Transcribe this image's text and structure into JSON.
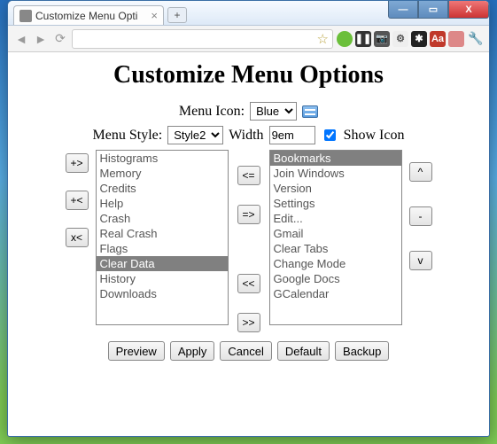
{
  "window": {
    "tab_title": "Customize Menu Opti",
    "newtab_glyph": "+",
    "min_glyph": "—",
    "max_glyph": "▭",
    "close_glyph": "X"
  },
  "toolbar": {
    "back_glyph": "◄",
    "fwd_glyph": "►",
    "reload_glyph": "⟳",
    "star_glyph": "☆",
    "wrench_glyph": "🔧",
    "ext_icons": [
      {
        "name": "green-dot",
        "bg": "#6bbf3a",
        "glyph": ""
      },
      {
        "name": "pause",
        "bg": "#333",
        "glyph": "❚❚"
      },
      {
        "name": "camera",
        "bg": "#555",
        "glyph": "📷"
      },
      {
        "name": "gears",
        "bg": "#eee",
        "glyph": "⚙",
        "fg": "#555"
      },
      {
        "name": "asterisk",
        "bg": "#222",
        "glyph": "✱"
      },
      {
        "name": "aa",
        "bg": "#c0392b",
        "glyph": "Aa"
      },
      {
        "name": "blank",
        "bg": "#d88",
        "glyph": ""
      }
    ]
  },
  "page": {
    "heading": "Customize Menu Options",
    "menu_icon_label": "Menu Icon:",
    "menu_icon_value": "Blue",
    "menu_style_label": "Menu Style:",
    "menu_style_value": "Style2",
    "width_label": "Width",
    "width_value": "9em",
    "show_icon_label": "Show Icon",
    "show_icon_checked": true
  },
  "left_list": {
    "items": [
      "Histograms",
      "Memory",
      "Credits",
      "Help",
      "Crash",
      "Real Crash",
      "Flags",
      "Clear Data",
      "History",
      "Downloads"
    ],
    "selected_index": 7
  },
  "right_list": {
    "items": [
      "Bookmarks",
      "Join Windows",
      "Version",
      "Settings",
      "Edit...",
      "Gmail",
      "Clear Tabs",
      "Change Mode",
      "Google Docs",
      "GCalendar"
    ],
    "selected_index": 0
  },
  "side_buttons_left": [
    "+>",
    "+<",
    "x<"
  ],
  "mid_buttons": [
    "<=",
    "=>",
    "<<",
    ">>"
  ],
  "side_buttons_right": [
    "^",
    "-",
    "v"
  ],
  "bottom_buttons": [
    "Preview",
    "Apply",
    "Cancel",
    "Default",
    "Backup"
  ]
}
